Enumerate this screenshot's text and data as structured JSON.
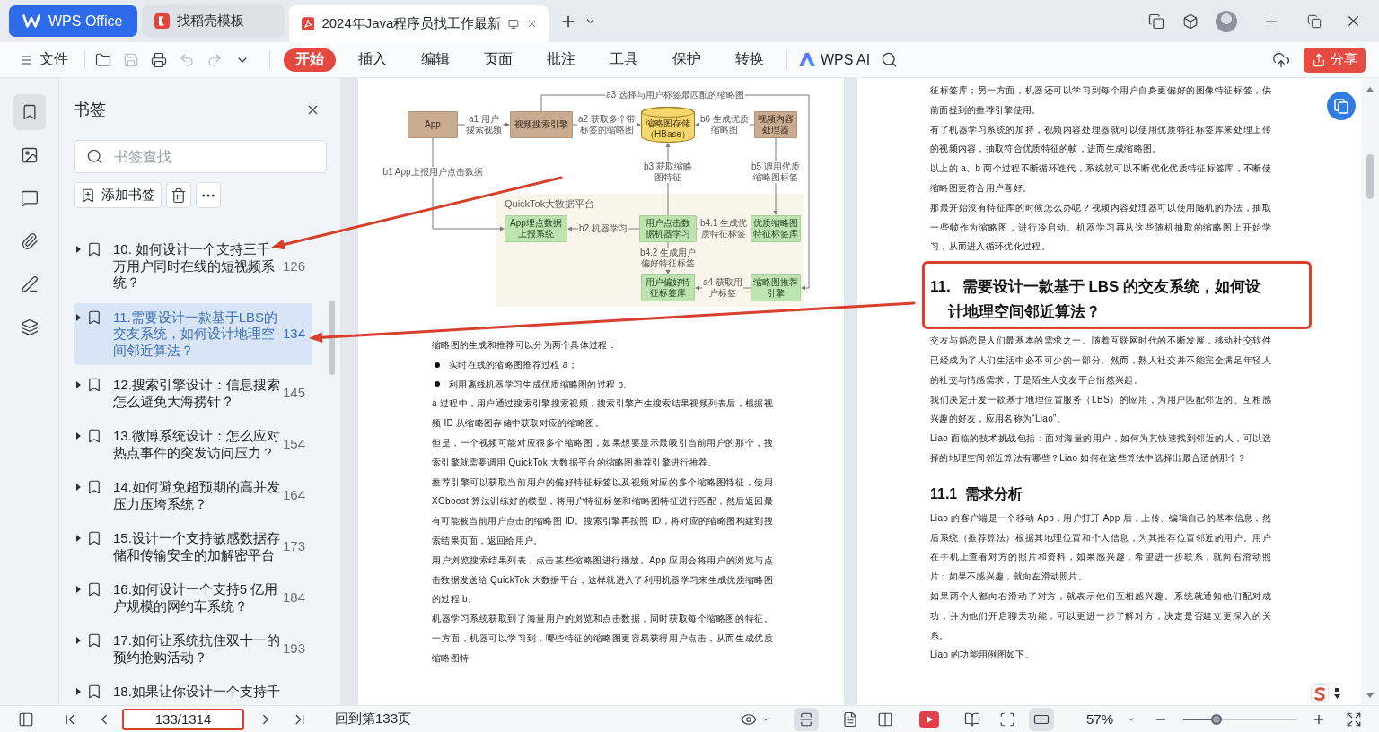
{
  "titlebar": {
    "tabs": [
      {
        "label": "WPS Office",
        "kind": "home",
        "selected": false
      },
      {
        "label": "找稻壳模板",
        "kind": "template",
        "selected": false
      },
      {
        "label": "2024年Java程序员找工作最新",
        "kind": "pdf",
        "selected": true
      }
    ]
  },
  "toolbar": {
    "file_menu": "文件",
    "quick_actions": [
      {
        "kind": "open",
        "disabled": false
      },
      {
        "kind": "save",
        "disabled": true
      },
      {
        "kind": "print",
        "disabled": false
      },
      {
        "kind": "undo",
        "disabled": true
      },
      {
        "kind": "redo",
        "disabled": true
      }
    ],
    "ribbon_tabs": [
      {
        "label": "开始",
        "selected": true
      },
      {
        "label": "插入",
        "selected": false
      },
      {
        "label": "编辑",
        "selected": false
      },
      {
        "label": "页面",
        "selected": false
      },
      {
        "label": "批注",
        "selected": false
      },
      {
        "label": "工具",
        "selected": false
      },
      {
        "label": "保护",
        "selected": false
      },
      {
        "label": "转换",
        "selected": false
      }
    ],
    "ai_button": "WPS AI",
    "share_button": "分享"
  },
  "sidebar": {
    "rail": [
      {
        "kind": "bookmarks",
        "selected": true
      },
      {
        "kind": "images",
        "selected": false
      },
      {
        "kind": "comments",
        "selected": false
      },
      {
        "kind": "attachments",
        "selected": false
      },
      {
        "kind": "signatures",
        "selected": false
      },
      {
        "kind": "layers",
        "selected": false
      }
    ],
    "panel": {
      "title": "书签",
      "search": {
        "placeholder": "书签查找"
      },
      "add_button": "添加书签",
      "bookmarks": [
        {
          "title": "10. 如何设计一个支持三千万用户同时在线的短视频系统？",
          "page": "126",
          "expanded": false,
          "selected": false
        },
        {
          "title": "11.需要设计一款基于LBS的交友系统，如何设计地理空间邻近算法？",
          "page": "134",
          "expanded": false,
          "selected": true
        },
        {
          "title": "12.搜索引擎设计：信息搜索怎么避免大海捞针？",
          "page": "145",
          "expanded": false,
          "selected": false
        },
        {
          "title": "13.微博系统设计：怎么应对热点事件的突发访问压力？",
          "page": "154",
          "expanded": false,
          "selected": false
        },
        {
          "title": "14.如何避免超预期的高并发压力压垮系统？",
          "page": "164",
          "expanded": false,
          "selected": false
        },
        {
          "title": "15.设计一个支持敏感数据存储和传输安全的加解密平台",
          "page": "173",
          "expanded": false,
          "selected": false
        },
        {
          "title": "16.如何设计一个支持5 亿用户规模的网约车系统？",
          "page": "184",
          "expanded": false,
          "selected": false
        },
        {
          "title": "17.如何让系统抗住双十一的预约抢购活动？",
          "page": "193",
          "expanded": false,
          "selected": false
        },
        {
          "title": "18.如果让你设计一个支持千",
          "expanded": false,
          "selected": false
        }
      ]
    }
  },
  "document": {
    "left_page": {
      "figure": {
        "group": "QuickTok大数据平台",
        "nodes": [
          {
            "label": "App",
            "kind": "service"
          },
          {
            "label": "视频搜索引擎",
            "kind": "service"
          },
          {
            "label": "缩略图存储（HBase）",
            "kind": "storage"
          },
          {
            "label": "视频内容处理器",
            "kind": "service"
          },
          {
            "label": "App埋点数据上报系统",
            "kind": "platform"
          },
          {
            "label": "用户点击数据机器学习",
            "kind": "platform"
          },
          {
            "label": "优质缩略图特征标签库",
            "kind": "platform"
          },
          {
            "label": "用户偏好特征标签库",
            "kind": "platform"
          },
          {
            "label": "缩略图推荐引擎",
            "kind": "platform"
          }
        ],
        "edges": [
          {
            "label": "a1 用户搜索视频"
          },
          {
            "label": "a2 获取多个带标签的缩略图"
          },
          {
            "label": "a3 选择与用户标签最匹配的缩略图"
          },
          {
            "label": "b6 生成优质缩略图"
          },
          {
            "label": "b1 App上报用户点击数据"
          },
          {
            "label": "b3 获取缩略图特征"
          },
          {
            "label": "b5 调用优质缩略图标签"
          },
          {
            "label": "b2 机器学习"
          },
          {
            "label": "b4.1 生成优质特征标签"
          },
          {
            "label": "b4.2 生成用户偏好特征标签"
          },
          {
            "label": "a4 获取用户标签"
          }
        ]
      },
      "blocks": [
        {
          "kind": "paragraph",
          "text": "缩略图的生成和推荐可以分为两个具体过程："
        },
        {
          "kind": "bullet",
          "text": "实时在线的缩略图推荐过程 a；"
        },
        {
          "kind": "bullet",
          "text": "利用离线机器学习生成优质缩略图的过程 b。"
        },
        {
          "kind": "paragraph",
          "text": "a 过程中，用户通过搜索引擎搜索视频，搜索引擎产生搜索结果视频列表后，根据视频 ID 从缩略图存储中获取对应的缩略图。"
        },
        {
          "kind": "paragraph",
          "text": "但是，一个视频可能对应很多个缩略图，如果想要显示最吸引当前用户的那个，搜索引擎就需要调用 QuickTok 大数据平台的缩略图推荐引擎进行推荐。"
        },
        {
          "kind": "paragraph",
          "text": "推荐引擎可以获取当前用户的偏好特征标签以及视频对应的多个缩略图特征，使用 XGboost 算法训练好的模型，将用户特征标签和缩略图特征进行匹配，然后返回最有可能被当前用户点击的缩略图 ID。搜索引擎再按照 ID，将对应的缩略图构建到搜索结果页面，返回给用户。"
        },
        {
          "kind": "paragraph",
          "text": "用户浏览搜索结果列表，点击某些缩略图进行播放。App 应用会将用户的浏览与点击数据发送给 QuickTok 大数据平台，这样就进入了利用机器学习来生成优质缩略图的过程 b。"
        },
        {
          "kind": "paragraph",
          "text": "机器学习系统获取到了海量用户的浏览和点击数据，同时获取每个缩略图的特征。一方面，机器可以学习到，哪些特征的缩略图更容易获得用户点击，从而生成优质缩略图特"
        }
      ]
    },
    "right_page": {
      "blocks": [
        {
          "kind": "paragraph",
          "text": "征标签库；另一方面，机器还可以学习到每个用户自身更偏好的图像特征标签，供前面提到的推荐引擎使用。"
        },
        {
          "kind": "paragraph",
          "text": "有了机器学习系统的加持，视频内容处理器就可以使用优质特征标签库来处理上传的视频内容，抽取符合优质特征的帧，进而生成缩略图。"
        },
        {
          "kind": "paragraph",
          "text": "以上的 a、b 两个过程不断循环迭代，系统就可以不断优化优质特征标签库，不断使缩略图更符合用户喜好。"
        },
        {
          "kind": "paragraph",
          "text": "那最开始没有特征库的时候怎么办呢？视频内容处理器可以使用随机的办法，抽取一些帧作为缩略图，进行冷启动。机器学习再从这些随机抽取的缩略图上开始学习，从而进入循环优化过程。"
        },
        {
          "kind": "heading",
          "number": "11.",
          "text": "需要设计一款基于 LBS 的交友系统，如何设计地理空间邻近算法？",
          "highlighted": true
        },
        {
          "kind": "paragraph",
          "text": "交友与婚恋是人们最基本的需求之一。随着互联网时代的不断发展，移动社交软件已经成为了人们生活中必不可少的一部分。然而，熟人社交并不能完全满足年轻人的社交与情感需求，于是陌生人交友平台悄然兴起。"
        },
        {
          "kind": "paragraph",
          "text": "我们决定开发一款基于地理位置服务（LBS）的应用，为用户匹配邻近的、互相感兴趣的好友，应用名称为“Liao”。"
        },
        {
          "kind": "paragraph",
          "text": "Liao 面临的技术挑战包括：面对海量的用户，如何为其快速找到邻近的人，可以选择的地理空间邻近算法有哪些？Liao 如何在这些算法中选择出最合适的那个？"
        },
        {
          "kind": "subheading",
          "number": "11.1",
          "text": "需求分析"
        },
        {
          "kind": "paragraph",
          "text": "Liao 的客户端是一个移动 App，用户打开 App 后，上传、编辑自己的基本信息，然后系统（推荐算法）根据其地理位置和个人信息，为其推荐位置邻近的用户。用户在手机上查看对方的照片和资料，如果感兴趣，希望进一步联系，就向右滑动照片；如果不感兴趣，就向左滑动照片。"
        },
        {
          "kind": "paragraph",
          "text": "如果两个人都向右滑动了对方，就表示他们互相感兴趣。系统就通知他们配对成功，并为他们开启聊天功能，可以更进一步了解对方，决定是否建立更深入的关系。"
        },
        {
          "kind": "paragraph",
          "text": "Liao 的功能用例图如下。"
        }
      ]
    }
  },
  "statusbar": {
    "page_field": {
      "value": "133/1314",
      "highlighted": true
    },
    "goto_link": "回到第133页",
    "view_buttons": [
      {
        "kind": "fit-height",
        "selected": true
      },
      {
        "kind": "single-page",
        "selected": false
      },
      {
        "kind": "two-page",
        "selected": false
      },
      {
        "kind": "play",
        "selected": false
      },
      {
        "kind": "book",
        "selected": false
      },
      {
        "kind": "focus",
        "selected": false
      },
      {
        "kind": "fit-width",
        "selected": true
      }
    ],
    "zoom": {
      "reading": "57%",
      "level": 0.29
    }
  }
}
